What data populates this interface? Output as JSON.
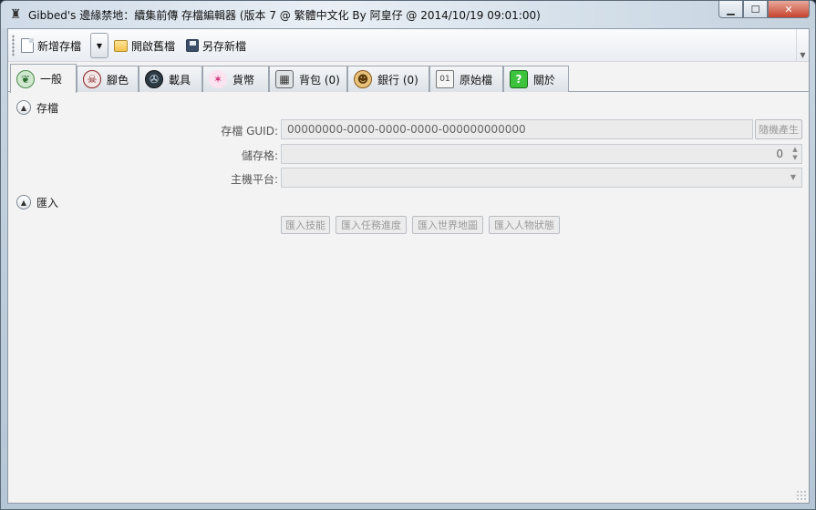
{
  "window": {
    "title": "Gibbed's 邊緣禁地：續集前傳 存檔編輯器 (版本 7 @ 繁體中文化 By 阿皇仔 @ 2014/10/19 09:01:00)"
  },
  "toolbar": {
    "new_label": "新增存檔",
    "open_label": "開啟舊檔",
    "saveas_label": "另存新檔"
  },
  "tabs": [
    {
      "label": "一般",
      "icon": "emblem-icon"
    },
    {
      "label": "腳色",
      "icon": "skull-icon"
    },
    {
      "label": "載具",
      "icon": "vehicle-icon"
    },
    {
      "label": "貨幣",
      "icon": "currency-icon"
    },
    {
      "label": "背包 (0)",
      "icon": "backpack-icon"
    },
    {
      "label": "銀行 (0)",
      "icon": "bank-icon"
    },
    {
      "label": "原始檔",
      "icon": "raw-file-icon"
    },
    {
      "label": "關於",
      "icon": "about-icon"
    }
  ],
  "save_section": {
    "header": "存檔",
    "guid_label": "存檔 GUID:",
    "guid_value": "00000000-0000-0000-0000-000000000000",
    "random_button": "隨機產生",
    "slot_label": "儲存格:",
    "slot_value": "0",
    "platform_label": "主機平台:",
    "platform_value": ""
  },
  "import_section": {
    "header": "匯入",
    "buttons": [
      "匯入技能",
      "匯入任務進度",
      "匯入世界地圖",
      "匯入人物狀態"
    ]
  },
  "colors": {
    "panel": "#f3f3f3",
    "close_button": "#c7442e",
    "disabled_text": "#9a9a9a"
  }
}
